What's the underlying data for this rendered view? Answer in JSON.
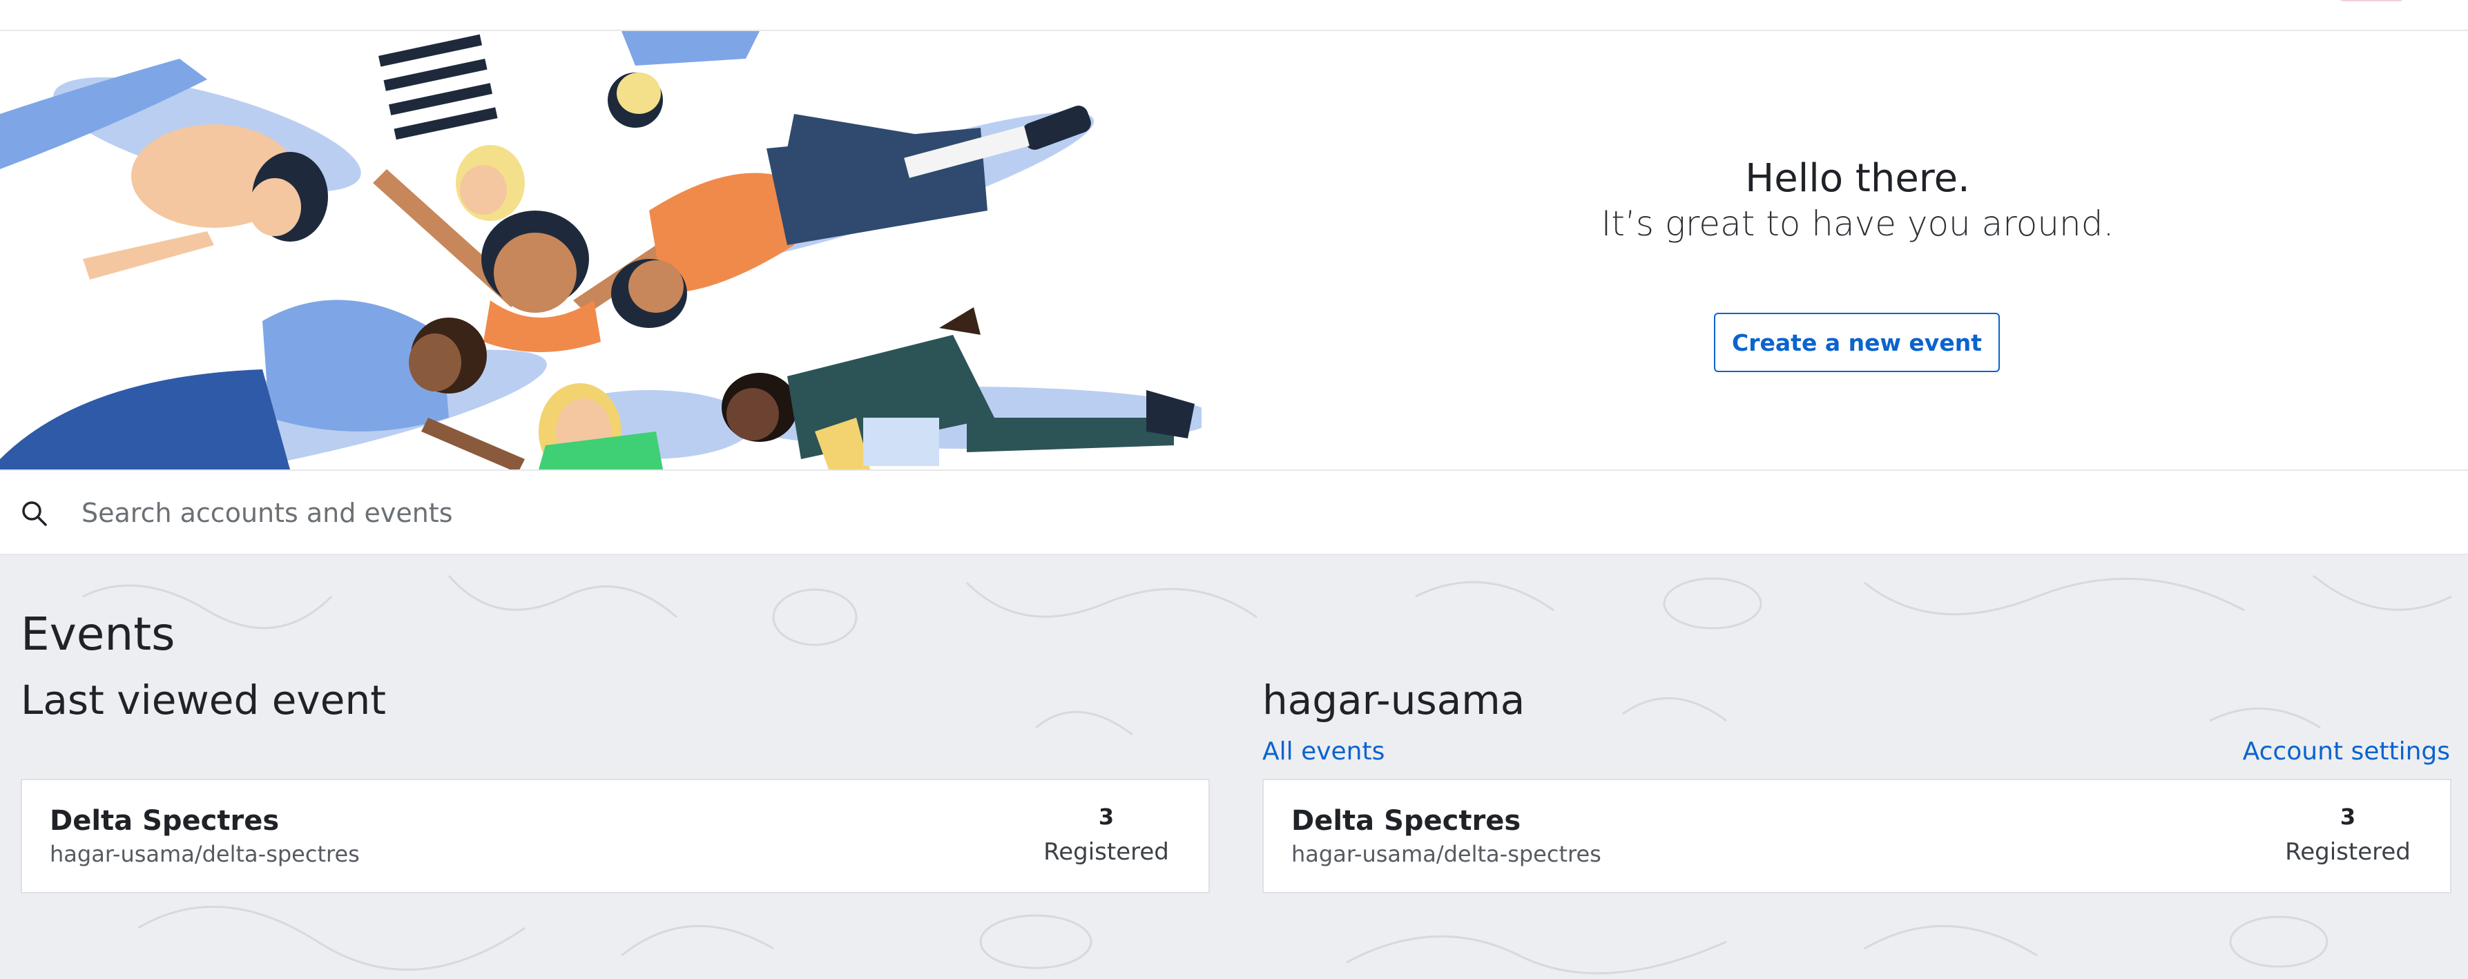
{
  "hero": {
    "title": "Hello there.",
    "subtitle": "It’s great to have you around.",
    "create_button_label": "Create a new event"
  },
  "search": {
    "placeholder": "Search accounts and events",
    "value": ""
  },
  "events_heading": "Events",
  "last_viewed": {
    "title": "Last viewed event",
    "card": {
      "name": "Delta Spectres",
      "slug": "hagar-usama/delta-spectres",
      "count": "3",
      "count_label": "Registered"
    }
  },
  "account": {
    "title": "hagar-usama",
    "all_events_link": "All events",
    "settings_link": "Account settings",
    "card": {
      "name": "Delta Spectres",
      "slug": "hagar-usama/delta-spectres",
      "count": "3",
      "count_label": "Registered"
    }
  },
  "colors": {
    "accent": "#0b63ce",
    "content_bg": "#eceef2",
    "hero_skin_orange": "#f08a4b",
    "hero_blue": "#7ea6e6",
    "hero_navy": "#2f4a6e",
    "hero_green": "#3fcf74"
  },
  "icons": {
    "search": "search-icon"
  }
}
